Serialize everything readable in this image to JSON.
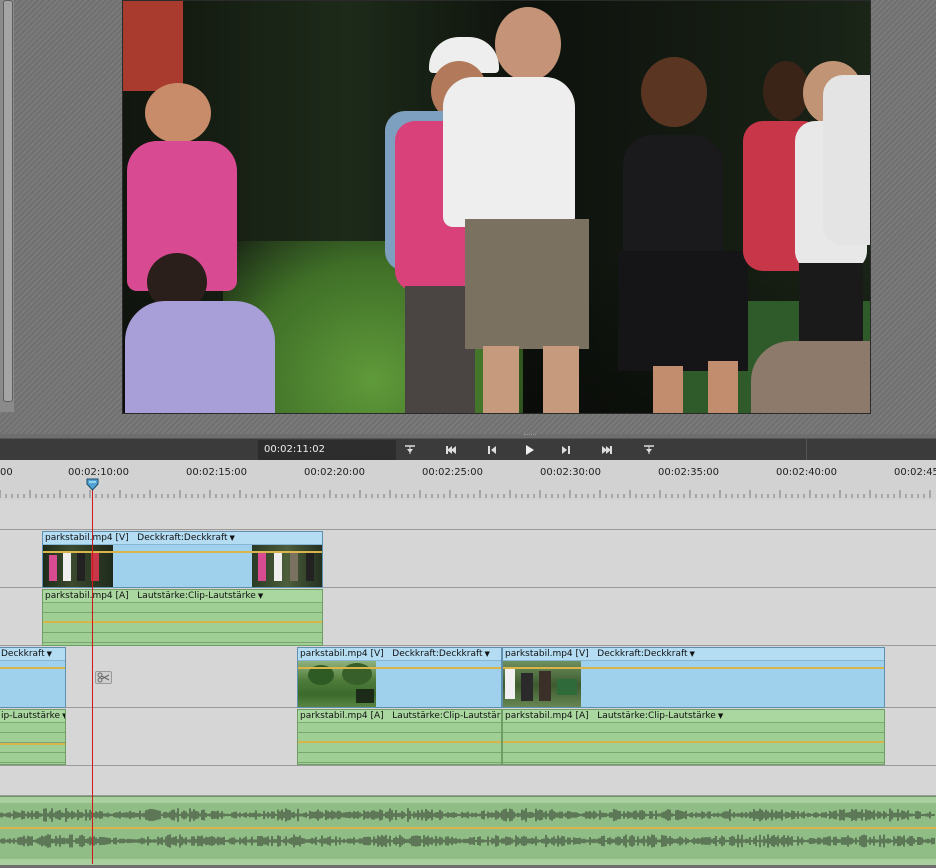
{
  "transport": {
    "timecode": "00:02:11:02",
    "buttons": [
      "goto-in-icon",
      "goto-previous-edit-icon",
      "step-back-icon",
      "play-icon",
      "step-forward-icon",
      "goto-next-edit-icon",
      "goto-out-icon"
    ]
  },
  "ruler": {
    "labels": [
      "00",
      "00:02:10:00",
      "00:02:15:00",
      "00:02:20:00",
      "00:02:25:00",
      "00:02:30:00",
      "00:02:35:00",
      "00:02:40:00",
      "00:02:45:"
    ]
  },
  "track1": {
    "video_clip": {
      "name": "parkstabil.mp4 [V]",
      "effect": "Deckkraft:Deckkraft"
    },
    "audio_clip": {
      "name": "parkstabil.mp4 [A]",
      "effect": "Lautstärke:Clip-Lautstärke"
    }
  },
  "track2": {
    "left_video_clip": {
      "effect": "Deckkraft"
    },
    "left_audio_clip": {
      "effect": "ip-Lautstärke"
    },
    "video_clips": [
      {
        "name": "parkstabil.mp4 [V]",
        "effect": "Deckkraft:Deckkraft"
      },
      {
        "name": "parkstabil.mp4 [V]",
        "effect": "Deckkraft:Deckkraft"
      }
    ],
    "audio_clips": [
      {
        "name": "parkstabil.mp4 [A]",
        "effect": "Lautstärke:Clip-Lautstärke"
      },
      {
        "name": "parkstabil.mp4 [A]",
        "effect": "Lautstärke:Clip-Lautstärke"
      }
    ]
  },
  "colors": {
    "playhead": "#d01818",
    "video_clip": "#a9d7f0",
    "audio_clip": "#9fcf94",
    "level_line": "#d8b44a"
  }
}
